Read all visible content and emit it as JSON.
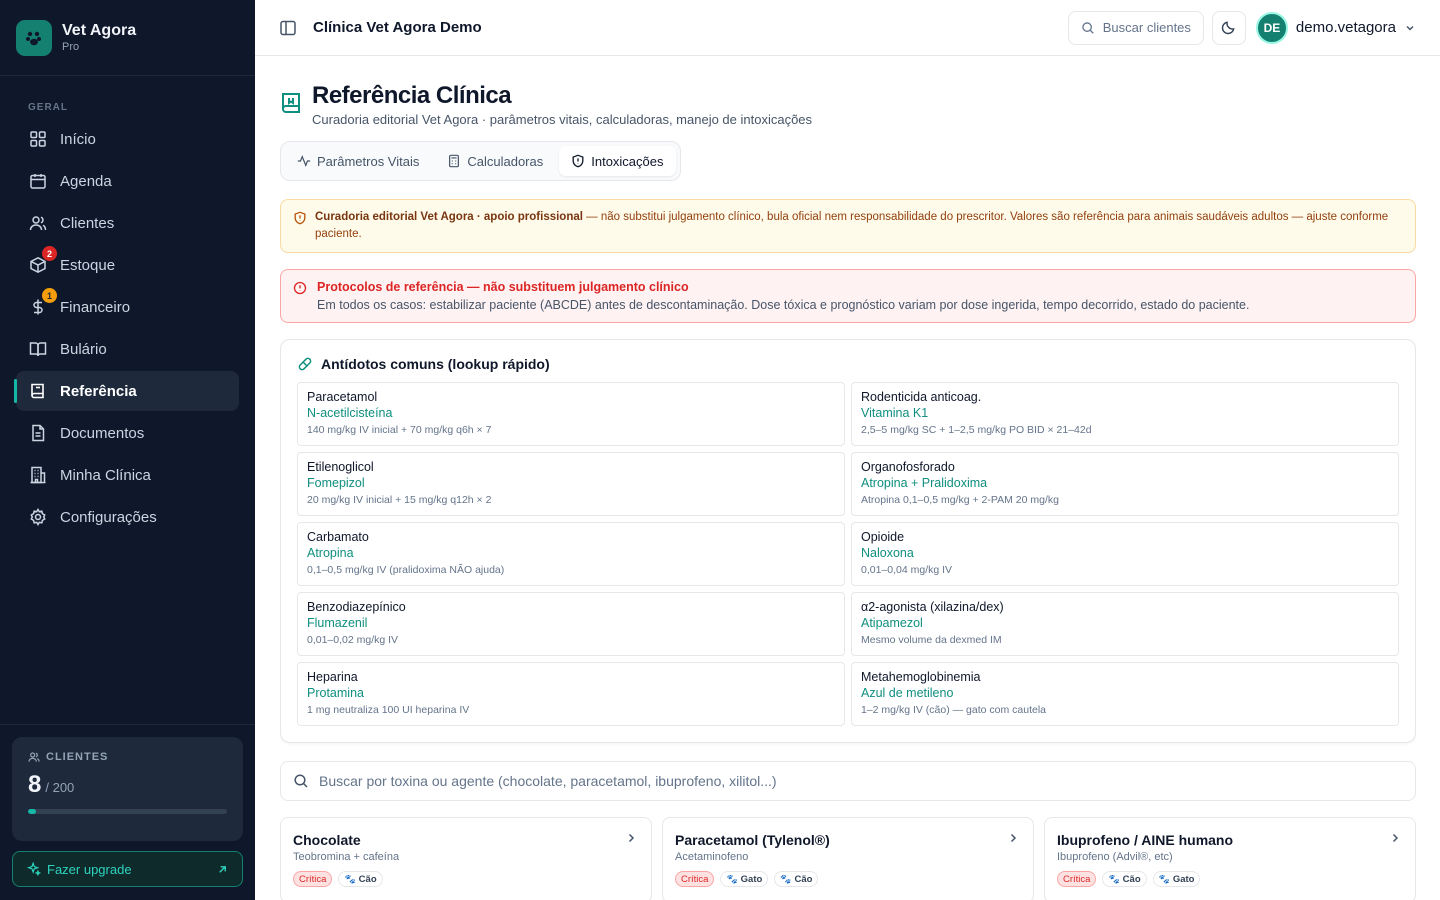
{
  "brand": {
    "name": "Vet Agora",
    "tier": "Pro"
  },
  "sidebar": {
    "section": "GERAL",
    "items": [
      {
        "label": "Início",
        "icon": "grid-icon"
      },
      {
        "label": "Agenda",
        "icon": "calendar-icon"
      },
      {
        "label": "Clientes",
        "icon": "users-icon"
      },
      {
        "label": "Estoque",
        "icon": "package-icon",
        "badge": "2"
      },
      {
        "label": "Financeiro",
        "icon": "dollar-icon",
        "badge": "1"
      },
      {
        "label": "Bulário",
        "icon": "open-book-icon"
      },
      {
        "label": "Referência",
        "icon": "book-icon",
        "active": true
      },
      {
        "label": "Documentos",
        "icon": "document-icon"
      },
      {
        "label": "Minha Clínica",
        "icon": "building-icon"
      },
      {
        "label": "Configurações",
        "icon": "gear-icon"
      }
    ],
    "clients": {
      "label": "CLIENTES",
      "value": "8",
      "limit": "/ 200",
      "fraction": 0.04
    },
    "upgrade": {
      "label": "Fazer upgrade"
    }
  },
  "topbar": {
    "clinic": "Clínica Vet Agora Demo",
    "search": "Buscar clientes",
    "avatar": "DE",
    "user": "demo.vetagora"
  },
  "page": {
    "title": "Referência Clínica",
    "subtitle": "Curadoria editorial Vet Agora · parâmetros vitais, calculadoras, manejo de intoxicações",
    "tabs": [
      {
        "label": "Parâmetros Vitais",
        "icon": "activity-icon"
      },
      {
        "label": "Calculadoras",
        "icon": "calculator-icon"
      },
      {
        "label": "Intoxicações",
        "icon": "shield-icon",
        "active": true
      }
    ]
  },
  "alerts": {
    "editorial_bold": "Curadoria editorial Vet Agora · apoio profissional",
    "editorial_text": " — não substitui julgamento clínico, bula oficial nem responsabilidade do prescritor. Valores são referência para animais saudáveis adultos — ajuste conforme paciente.",
    "protocol_title": "Protocolos de referência — não substituem julgamento clínico",
    "protocol_body": "Em todos os casos: estabilizar paciente (ABCDE) antes de descontaminação. Dose tóxica e prognóstico variam por dose ingerida, tempo decorrido, estado do paciente."
  },
  "antidotes": {
    "title": "Antídotos comuns (lookup rápido)",
    "items": [
      {
        "toxin": "Paracetamol",
        "antidote": "N-acetilcisteína",
        "dose": "140 mg/kg IV inicial + 70 mg/kg q6h × 7"
      },
      {
        "toxin": "Rodenticida anticoag.",
        "antidote": "Vitamina K1",
        "dose": "2,5–5 mg/kg SC + 1–2,5 mg/kg PO BID × 21–42d"
      },
      {
        "toxin": "Etilenoglicol",
        "antidote": "Fomepizol",
        "dose": "20 mg/kg IV inicial + 15 mg/kg q12h × 2"
      },
      {
        "toxin": "Organofosforado",
        "antidote": "Atropina + Pralidoxima",
        "dose": "Atropina 0,1–0,5 mg/kg + 2-PAM 20 mg/kg"
      },
      {
        "toxin": "Carbamato",
        "antidote": "Atropina",
        "dose": "0,1–0,5 mg/kg IV (pralidoxima NÃO ajuda)"
      },
      {
        "toxin": "Opioide",
        "antidote": "Naloxona",
        "dose": "0,01–0,04 mg/kg IV"
      },
      {
        "toxin": "Benzodiazepínico",
        "antidote": "Flumazenil",
        "dose": "0,01–0,02 mg/kg IV"
      },
      {
        "toxin": "α2-agonista (xilazina/dex)",
        "antidote": "Atipamezol",
        "dose": "Mesmo volume da dexmed IM"
      },
      {
        "toxin": "Heparina",
        "antidote": "Protamina",
        "dose": "1 mg neutraliza 100 UI heparina IV"
      },
      {
        "toxin": "Metahemoglobinemia",
        "antidote": "Azul de metileno",
        "dose": "1–2 mg/kg IV (cão) — gato com cautela"
      }
    ]
  },
  "toxin_search": {
    "placeholder": "Buscar por toxina ou agente (chocolate, paracetamol, ibuprofeno, xilitol...)"
  },
  "toxins": [
    {
      "name": "Chocolate",
      "agent": "Teobromina + cafeína",
      "severity": "Crítica",
      "species": [
        "Cão"
      ]
    },
    {
      "name": "Paracetamol (Tylenol®)",
      "agent": "Acetaminofeno",
      "severity": "Crítica",
      "species": [
        "Gato",
        "Cão"
      ]
    },
    {
      "name": "Ibuprofeno / AINE humano",
      "agent": "Ibuprofeno (Advil®, etc)",
      "severity": "Crítica",
      "species": [
        "Cão",
        "Gato"
      ]
    }
  ]
}
